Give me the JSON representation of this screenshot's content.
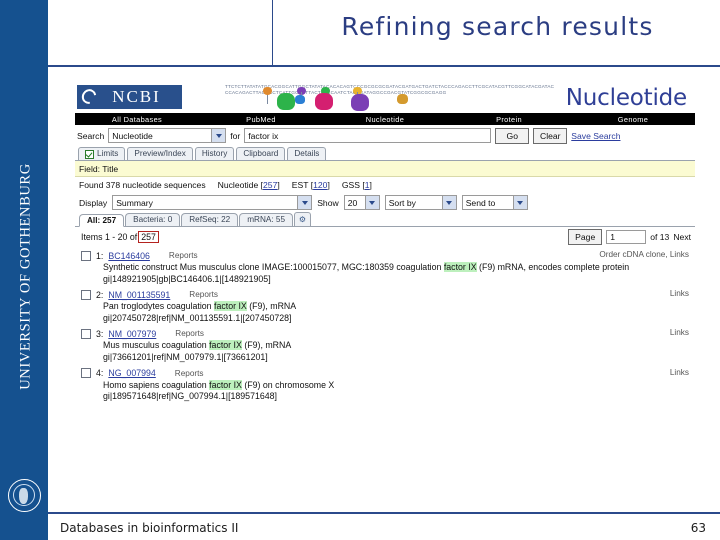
{
  "slide": {
    "title": "Refining search results",
    "sidebar_label": "UNIVERSITY OF GOTHENBURG",
    "footer_text": "Databases in bioinformatics II",
    "page_number": "63",
    "accent_color": "#2b3d82",
    "sidebar_color": "#15518f"
  },
  "ncbi": {
    "logo_text": "NCBI",
    "banner_word": "Nucleotide",
    "dna_art_text": "TTCTCTTATATATGCACGGCATTGGCTATATACACACAGTCCCGCGCGCGATACGATGACTGATCTACCCAGACCTTCGCATACGTTCGGCATACGATACCCACAGACTTACGCCTCATTGCACTTACTAACCAATCTAGAGATAGGCCGACGTATCGGCGCGAGG",
    "nav_items": [
      "All Databases",
      "PubMed",
      "Nucleotide",
      "Protein",
      "Genome"
    ],
    "search": {
      "label": "Search",
      "database_selected": "Nucleotide",
      "for_label": "for",
      "query_value": "factor ix",
      "query_placeholder": "",
      "go_label": "Go",
      "clear_label": "Clear",
      "save_search_label": "Save Search"
    },
    "toolbar_tabs": [
      "Limits",
      "Preview/Index",
      "History",
      "Clipboard",
      "Details"
    ],
    "field_bar": "Field: Title",
    "counts": {
      "found_text": "Found 378 nucleotide sequences",
      "groups": [
        {
          "name": "Nucleotide",
          "count": "257"
        },
        {
          "name": "EST",
          "count": "120"
        },
        {
          "name": "GSS",
          "count": "1"
        }
      ]
    },
    "display_bar": {
      "display_label": "Display",
      "display_value": "Summary",
      "show_label": "Show",
      "show_value": "20",
      "sort_value": "Sort by",
      "send_value": "Send to"
    },
    "category_tabs": [
      {
        "label": "All: 257",
        "active": true
      },
      {
        "label": "Bacteria: 0",
        "active": false
      },
      {
        "label": "RefSeq: 22",
        "active": false
      },
      {
        "label": "mRNA: 55",
        "active": false
      }
    ],
    "items_row": {
      "prefix": "Items 1 - 20 of",
      "highlight_count": "257",
      "page_label": "Page",
      "page_value": "1",
      "of_text": "of 13",
      "next_label": "Next"
    },
    "results": [
      {
        "num": "1:",
        "accession": "BC146406",
        "reports_label": "Reports",
        "links_label": "Order cDNA clone, Links",
        "desc_pre": "Synthetic construct Mus musculus clone IMAGE:100015077, MGC:180359 coagulation ",
        "desc_hl": "factor IX",
        "desc_post": " (F9) mRNA, encodes complete protein",
        "gi": "gi|148921905|gb|BC146406.1|[148921905]"
      },
      {
        "num": "2:",
        "accession": "NM_001135591",
        "reports_label": "Reports",
        "links_label": "Links",
        "desc_pre": "Pan troglodytes coagulation ",
        "desc_hl": "factor IX",
        "desc_post": " (F9), mRNA",
        "gi": "gi|207450728|ref|NM_001135591.1|[207450728]"
      },
      {
        "num": "3:",
        "accession": "NM_007979",
        "reports_label": "Reports",
        "links_label": "Links",
        "desc_pre": "Mus musculus coagulation ",
        "desc_hl": "factor IX",
        "desc_post": " (F9), mRNA",
        "gi": "gi|73661201|ref|NM_007979.1|[73661201]"
      },
      {
        "num": "4:",
        "accession": "NG_007994",
        "reports_label": "Reports",
        "links_label": "Links",
        "desc_pre": "Homo sapiens coagulation ",
        "desc_hl": "factor IX",
        "desc_post": " (F9) on chromosome X",
        "gi": "gi|189571648|ref|NG_007994.1|[189571648]"
      }
    ]
  }
}
